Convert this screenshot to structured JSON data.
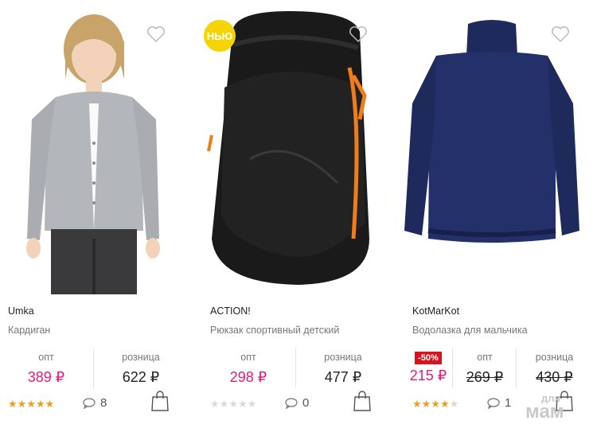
{
  "products": [
    {
      "brand": "Umka",
      "title": "Кардиган",
      "opt_label": "опт",
      "opt_price": "389 ₽",
      "retail_label": "розница",
      "retail_price": "622 ₽",
      "rating": 5,
      "rating_max": 5,
      "comments": "8",
      "image_icon": "cardigan-child-photo"
    },
    {
      "badge": "НЬЮ",
      "brand": "ACTION!",
      "title": "Рюкзак спортивный детский",
      "opt_label": "опт",
      "opt_price": "298 ₽",
      "retail_label": "розница",
      "retail_price": "477 ₽",
      "rating": 0,
      "rating_max": 5,
      "comments": "0",
      "image_icon": "backpack-photo"
    },
    {
      "brand": "KotMarKot",
      "title": "Водолазка для мальчика",
      "discount": "-50%",
      "sale_price": "215 ₽",
      "opt_label": "опт",
      "opt_price": "269 ₽",
      "retail_label": "розница",
      "retail_price": "430 ₽",
      "rating": 4,
      "rating_max": 5,
      "comments": "1",
      "image_icon": "turtleneck-photo"
    }
  ],
  "watermark": {
    "line1": "для",
    "line2": "мам"
  },
  "colors": {
    "accent_pink": "#e6197d",
    "star": "#f39c1e",
    "discount_red": "#d4141e",
    "badge_yellow": "#f5d400"
  }
}
